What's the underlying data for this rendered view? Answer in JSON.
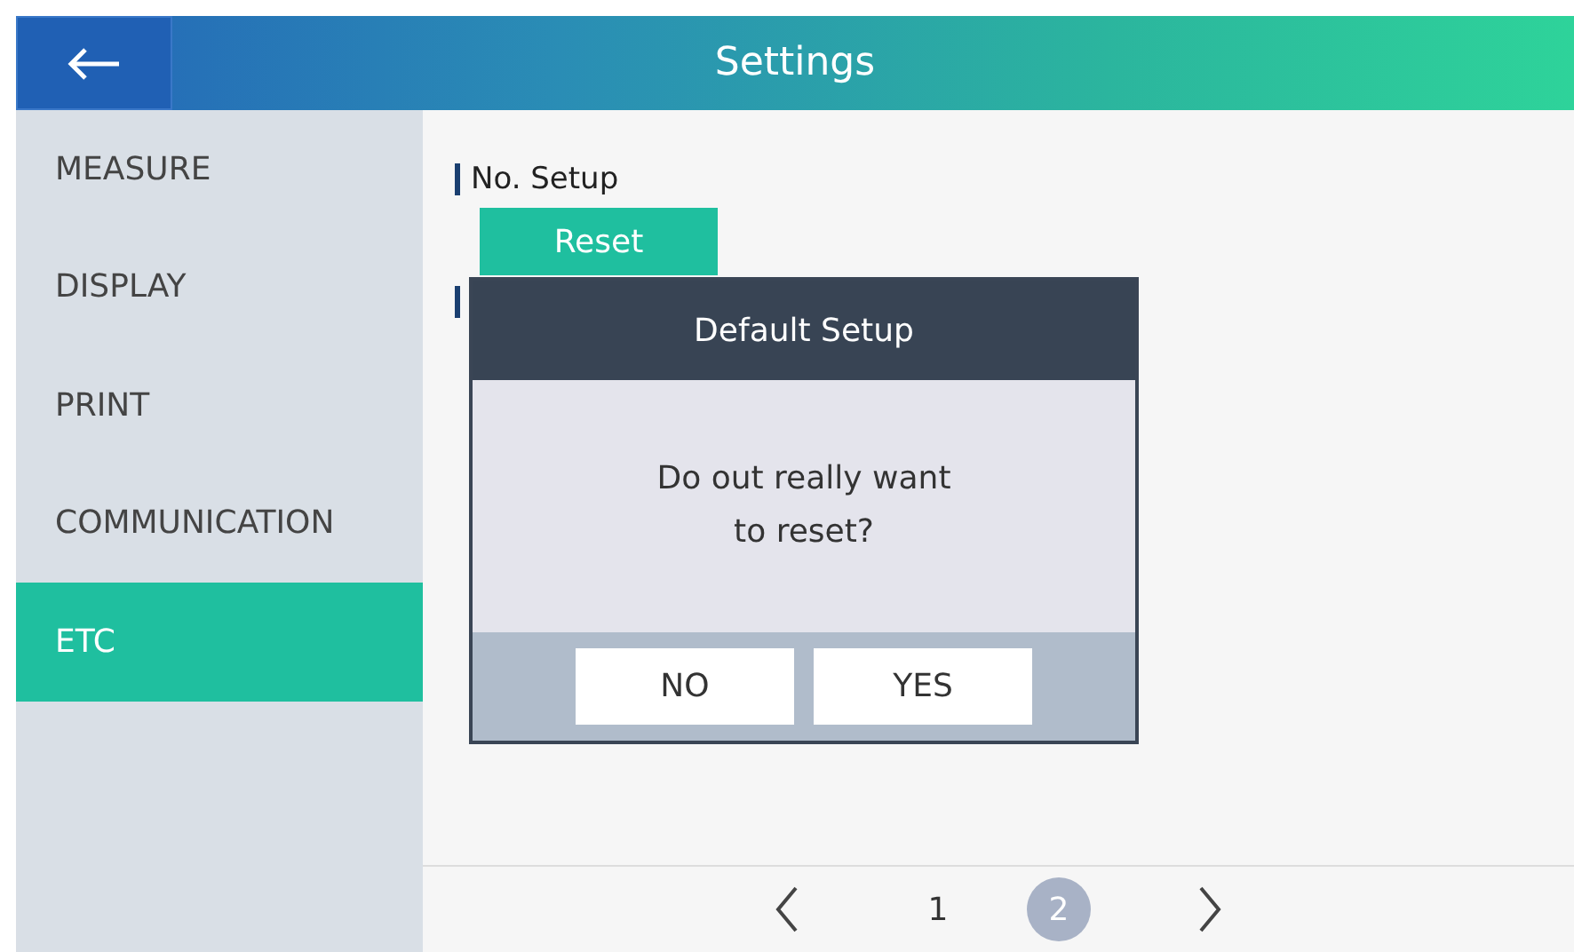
{
  "header": {
    "title": "Settings"
  },
  "sidebar": {
    "items": [
      {
        "label": "MEASURE",
        "selected": false
      },
      {
        "label": "DISPLAY",
        "selected": false
      },
      {
        "label": "PRINT",
        "selected": false
      },
      {
        "label": "COMMUNICATION",
        "selected": false
      },
      {
        "label": "ETC",
        "selected": true
      }
    ]
  },
  "section": {
    "title": "No. Setup",
    "button": "Reset"
  },
  "dialog": {
    "title": "Default Setup",
    "message_lines": [
      "Do out really want",
      "to reset?"
    ],
    "buttons": [
      "NO",
      "YES"
    ]
  },
  "pagination": {
    "pages": [
      {
        "label": "1",
        "selected": false
      },
      {
        "label": "2",
        "selected": true
      }
    ]
  }
}
